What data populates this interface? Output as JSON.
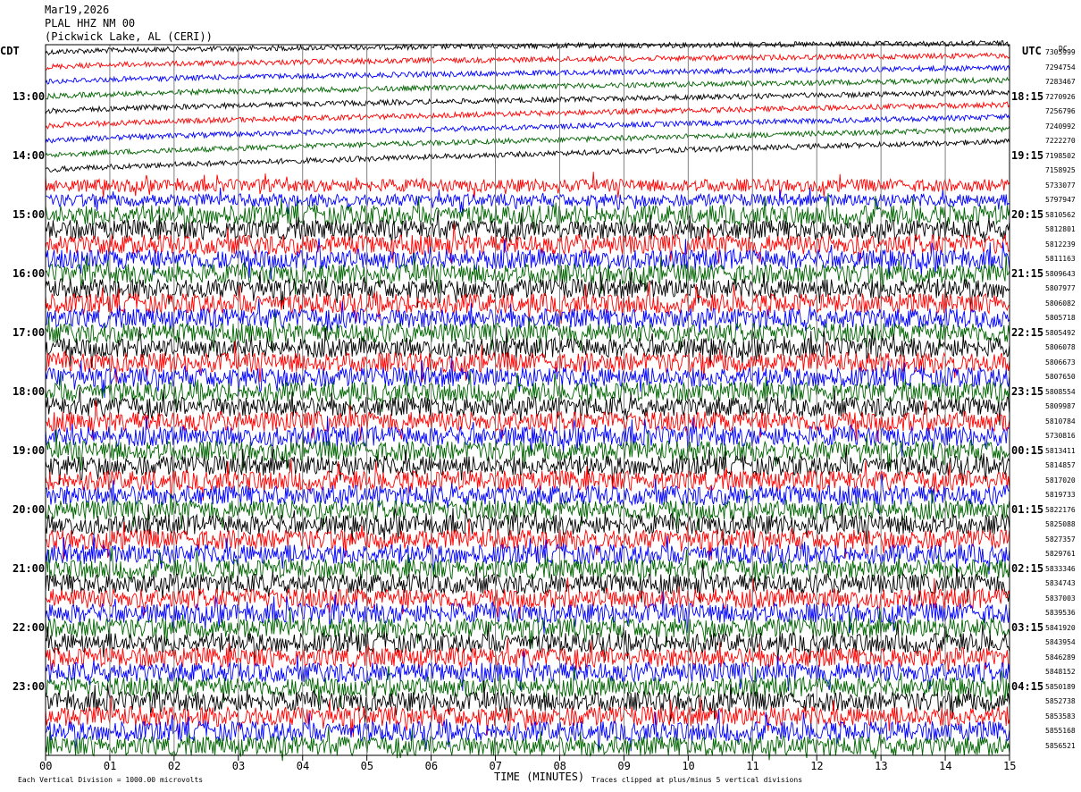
{
  "header": {
    "date": "Mar19,2026",
    "station": "PLAL HHZ NM 00",
    "location": "(Pickwick Lake, AL (CERI))"
  },
  "left_axis_label": "CDT",
  "right_axis_label": "UTC",
  "dc_label": "DC",
  "left_hours": [
    "13:00",
    "14:00",
    "15:00",
    "16:00",
    "17:00",
    "18:00",
    "19:00",
    "20:00",
    "21:00",
    "22:00",
    "23:00"
  ],
  "right_hours": [
    "18:15",
    "19:15",
    "20:15",
    "21:15",
    "22:15",
    "23:15",
    "00:15",
    "01:15",
    "02:15",
    "03:15",
    "04:15"
  ],
  "dc_offsets": [
    "7305999",
    "7294754",
    "7283467",
    "7270926",
    "7256796",
    "7240992",
    "7222270",
    "7198502",
    "7158925",
    "5733077",
    "5797947",
    "5810562",
    "5812801",
    "5812239",
    "5811163",
    "5809643",
    "5807977",
    "5806082",
    "5805718",
    "5805492",
    "5806078",
    "5806673",
    "5807650",
    "5808554",
    "5809987",
    "5810784",
    "5730816",
    "5813411",
    "5814857",
    "5817020",
    "5819733",
    "5822176",
    "5825088",
    "5827357",
    "5829761",
    "5833346",
    "5834743",
    "5837003",
    "5839536",
    "5841920",
    "5843954",
    "5846289",
    "5848152",
    "5850189",
    "5852738",
    "5853583",
    "5855168",
    "5856521"
  ],
  "time_axis": {
    "ticks": [
      "00",
      "01",
      "02",
      "03",
      "04",
      "05",
      "06",
      "07",
      "08",
      "09",
      "10",
      "11",
      "12",
      "13",
      "14",
      "15"
    ],
    "title": "TIME (MINUTES)"
  },
  "footer": {
    "scale_note": "Each Vertical Division = 1000.00 microvolts",
    "clip_note": "Traces clipped at plus/minus 5 vertical divisions"
  },
  "colors": {
    "trace_cycle": [
      "#000000",
      "#ff0000",
      "#0000ff",
      "#006400"
    ],
    "grid": "#808080"
  },
  "chart_data": {
    "type": "line",
    "title": "PLAL HHZ NM 00",
    "xlabel": "TIME (MINUTES)",
    "xlim": [
      0,
      15
    ],
    "rows": 48,
    "row_minutes": 15,
    "start_time_cdt": "12:15",
    "vertical_division_microvolts": 1000.0,
    "clip_divisions": 5,
    "grid": true
  }
}
